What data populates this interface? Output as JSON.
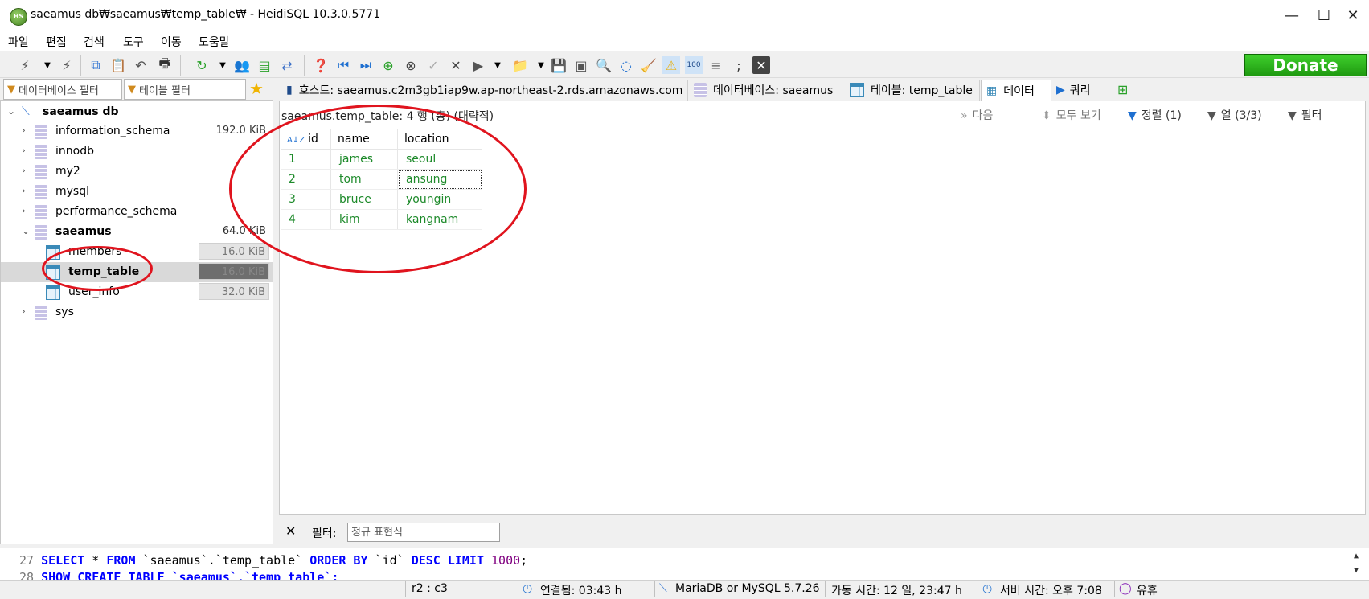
{
  "window": {
    "title": "saeamus db₩saeamus₩temp_table₩ - HeidiSQL 10.3.0.5771",
    "icon_text": "HS",
    "minimize_glyph": "—",
    "maximize_glyph": "☐",
    "close_glyph": "✕"
  },
  "menu": [
    "파일",
    "편집",
    "검색",
    "도구",
    "이동",
    "도움말"
  ],
  "toolbar": {
    "donate_label": "Donate"
  },
  "left_panel": {
    "db_filter_placeholder": "데이터베이스 필터",
    "table_filter_placeholder": "테이블 필터",
    "root": "saeamus db",
    "databases": [
      {
        "name": "information_schema",
        "size": "192.0 KiB"
      },
      {
        "name": "innodb",
        "size": ""
      },
      {
        "name": "my2",
        "size": ""
      },
      {
        "name": "mysql",
        "size": ""
      },
      {
        "name": "performance_schema",
        "size": ""
      },
      {
        "name": "saeamus",
        "size": "64.0 KiB"
      },
      {
        "name": "sys",
        "size": ""
      }
    ],
    "tables": [
      {
        "name": "members",
        "size": "16.0 KiB"
      },
      {
        "name": "temp_table",
        "size": "16.0 KiB"
      },
      {
        "name": "user_info",
        "size": "32.0 KiB"
      }
    ]
  },
  "tabs": {
    "host": "호스트: saeamus.c2m3gb1iap9w.ap-northeast-2.rds.amazonaws.com",
    "database": "데이터베이스: saeamus",
    "table": "테이블: temp_table",
    "data": "데이터",
    "query": "쿼리"
  },
  "grid": {
    "info": "saeamus.temp_table: 4 행 (총) (대략적)",
    "next": "다음",
    "show_all": "모두 보기",
    "sort": "정렬 (1)",
    "columns_btn": "열 (3/3)",
    "filter_btn": "필터",
    "sort_glyph": "A↓Z",
    "columns": [
      "id",
      "name",
      "location"
    ],
    "rows": [
      [
        "1",
        "james",
        "seoul"
      ],
      [
        "2",
        "tom",
        "ansung"
      ],
      [
        "3",
        "bruce",
        "youngin"
      ],
      [
        "4",
        "kim",
        "kangnam"
      ]
    ]
  },
  "filter_bar": {
    "close": "✕",
    "label": "필터:",
    "placeholder": "정규 표현식"
  },
  "sql_log": {
    "line1_no": "27",
    "line1": {
      "select": "SELECT",
      "star": " * ",
      "from": "FROM",
      "table": " `saeamus`.`temp_table` ",
      "order": "ORDER BY",
      "col": " `id` ",
      "desc": "DESC",
      "limit": "LIMIT",
      "n": "1000",
      "end": ";"
    },
    "line2_no": "28",
    "line2": "SHOW CREATE TABLE `saeamus`.`temp_table`;"
  },
  "status": {
    "cursor": "r2 : c3",
    "connected": "연결됨: 03:43 h",
    "server": "MariaDB or MySQL 5.7.26",
    "uptime": "가동 시간: 12 일, 23:47 h",
    "server_time": "서버 시간: 오후 7:08",
    "idle": "유휴"
  },
  "colors": {
    "annotation": "#e0141e",
    "grid_text": "#1d8a2a",
    "keyword": "#0000ff",
    "donate": "#2eb81e"
  }
}
